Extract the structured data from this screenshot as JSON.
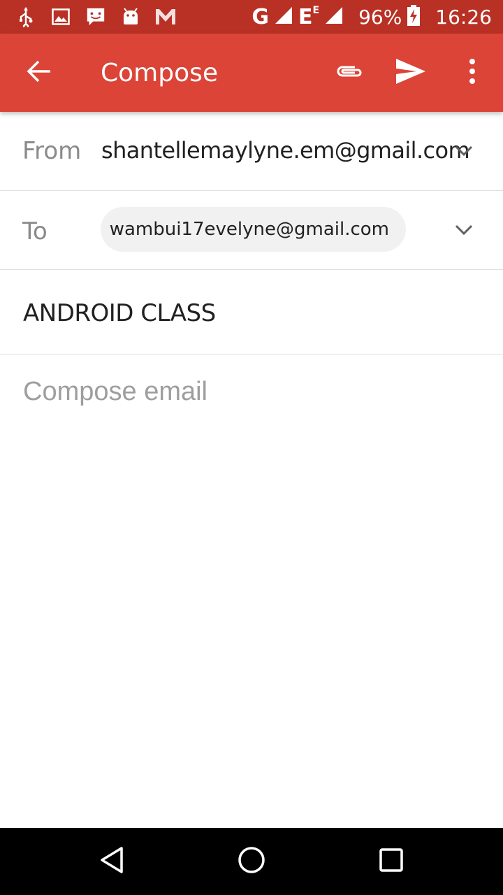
{
  "status_bar": {
    "icons": [
      "usb-icon",
      "image-icon",
      "chat-icon",
      "android-icon",
      "mail-icon"
    ],
    "network_1": "G",
    "network_2": "E",
    "network_2_sup": "E",
    "battery": "96%",
    "time": "16:26"
  },
  "app_bar": {
    "title": "Compose",
    "actions": [
      "attach-icon",
      "send-icon",
      "more-vert-icon"
    ],
    "color": "#db4437"
  },
  "compose": {
    "from_label": "From",
    "from_value": "shantellemaylyne.em@gmail.com",
    "to_label": "To",
    "to_chip": "wambui17evelyne@gmail.com",
    "subject": "ANDROID CLASS",
    "body_placeholder": "Compose email"
  },
  "nav_bar": {
    "buttons": [
      "back-triangle-icon",
      "home-circle-icon",
      "recents-square-icon"
    ]
  }
}
